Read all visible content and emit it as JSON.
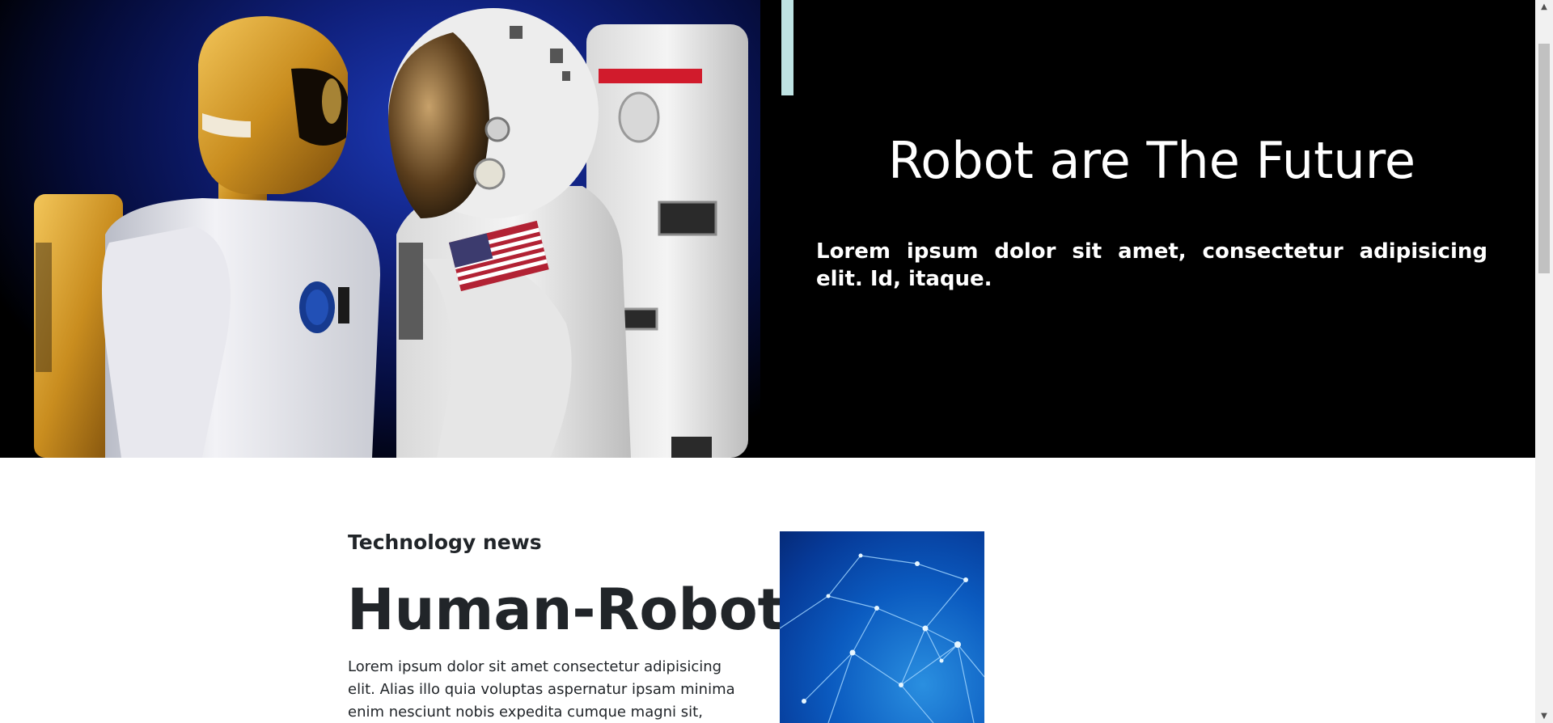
{
  "hero": {
    "title": "Robot are The Future",
    "text": "Lorem ipsum dolor sit amet, consectetur adipisicing elit. Id, itaque.",
    "accent_color": "#bfe3e3",
    "background": "#000000"
  },
  "news": {
    "kicker": "Technology news",
    "title": "Human-Robot",
    "body": "Lorem ipsum dolor sit amet consectetur adipisicing elit. Alias illo quia voluptas aspernatur ipsam minima enim nesciunt nobis expedita cumque magni sit, doloribus eos"
  },
  "scrollbar": {
    "up_icon": "▲",
    "down_icon": "▼"
  }
}
